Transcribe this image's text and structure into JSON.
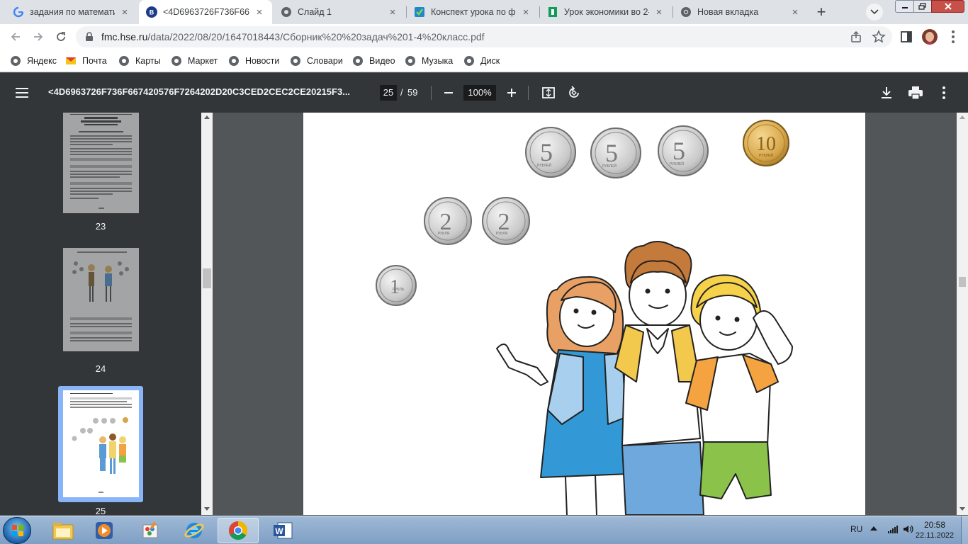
{
  "browser": {
    "tabs": [
      {
        "title": "задания по математик",
        "favicon": "google-g-icon",
        "active": false
      },
      {
        "title": "<4D6963726F736F6674",
        "favicon": "hse-logo-icon",
        "active": true
      },
      {
        "title": "Слайд 1",
        "favicon": "globe-icon",
        "active": false
      },
      {
        "title": "Конспект урока по фи",
        "favicon": "checkmark-icon",
        "active": false
      },
      {
        "title": "Урок экономики во 2-",
        "favicon": "green-doc-icon",
        "active": false
      },
      {
        "title": "Новая вкладка",
        "favicon": "chrome-icon",
        "active": false
      }
    ],
    "close_glyph": "×",
    "new_tab_glyph": "+",
    "address": {
      "host": "fmc.hse.ru",
      "path": "/data/2022/08/20/1647018443/Сборник%20%20задач%201-4%20класс.pdf"
    },
    "bookmarks": [
      {
        "label": "Яндекс",
        "icon": "globe-icon"
      },
      {
        "label": "Почта",
        "icon": "mail-icon"
      },
      {
        "label": "Карты",
        "icon": "globe-icon"
      },
      {
        "label": "Маркет",
        "icon": "globe-icon"
      },
      {
        "label": "Новости",
        "icon": "globe-icon"
      },
      {
        "label": "Словари",
        "icon": "globe-icon"
      },
      {
        "label": "Видео",
        "icon": "globe-icon"
      },
      {
        "label": "Музыка",
        "icon": "globe-icon"
      },
      {
        "label": "Диск",
        "icon": "globe-icon"
      }
    ]
  },
  "pdf": {
    "title": "<4D6963726F736F667420576F7264202D20C3CED2CEC2CE20215F3...",
    "current_page": "25",
    "page_sep": "/",
    "total_pages": "59",
    "zoom": "100%",
    "thumbnails": [
      {
        "label": "23",
        "selected": false
      },
      {
        "label": "24",
        "selected": false
      },
      {
        "label": "25",
        "selected": true
      }
    ]
  },
  "page_content": {
    "coins": [
      {
        "value": "5",
        "word": "РУБЛЕЙ",
        "metal": "silver"
      },
      {
        "value": "5",
        "word": "РУБЛЕЙ",
        "metal": "silver"
      },
      {
        "value": "5",
        "word": "РУБЛЕЙ",
        "metal": "silver"
      },
      {
        "value": "10",
        "word": "РУБЛЕЙ",
        "metal": "gold"
      },
      {
        "value": "2",
        "word": "РУБЛЯ",
        "metal": "silver"
      },
      {
        "value": "2",
        "word": "РУБЛЯ",
        "metal": "silver"
      },
      {
        "value": "1",
        "word": "РУБЛЬ",
        "metal": "silver"
      }
    ],
    "illustration": "three-children"
  },
  "taskbar": {
    "apps": [
      "explorer-icon",
      "media-player-icon",
      "paint-icon",
      "ie-icon",
      "chrome-icon",
      "word-icon"
    ],
    "active_app": "chrome-icon",
    "lang": "RU",
    "time": "20:58",
    "date": "22.11.2022"
  },
  "colors": {
    "tabstrip": "#dee1e6",
    "pdf_toolbar": "#323639",
    "viewer_bg": "#525659",
    "selected_thumb": "#8ab4f8",
    "coin_silver": "#c9c9c9",
    "coin_gold": "#d7a64a"
  }
}
